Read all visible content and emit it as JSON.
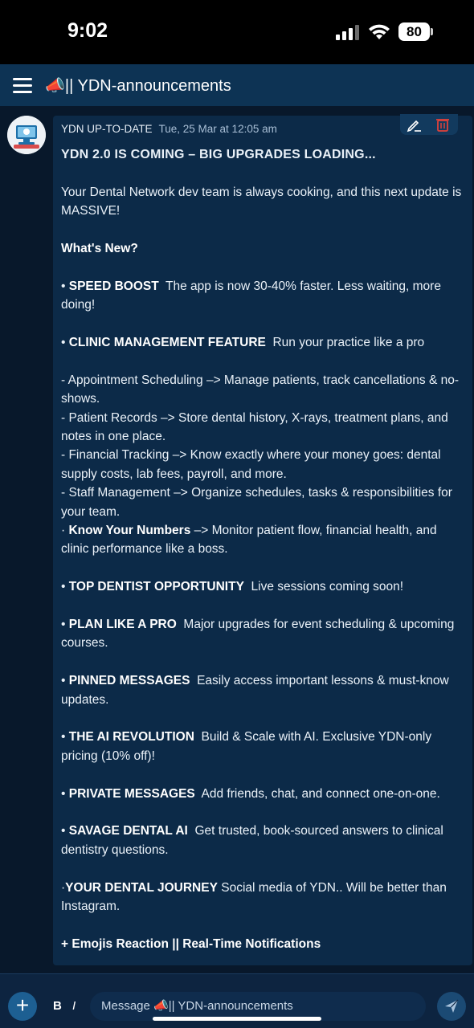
{
  "status_bar": {
    "time": "9:02",
    "battery": "80"
  },
  "header": {
    "channel_emoji": "📣",
    "channel_name": "|| YDN-announcements"
  },
  "message": {
    "author": "YDN UP-TO-DATE",
    "timestamp": "Tue, 25 Mar at 12:05 am",
    "title": "YDN 2.0 IS COMING – BIG UPGRADES LOADING...",
    "intro": "Your Dental Network dev team is always cooking, and this next update is MASSIVE!",
    "whats_new": "What's New?",
    "speed_boost_label": "SPEED BOOST",
    "speed_boost_text": "The app is now 30-40% faster. Less waiting, more doing!",
    "clinic_label": "CLINIC MANAGEMENT FEATURE",
    "clinic_text": "Run your practice like a pro",
    "appointment": "- Appointment Scheduling –> Manage patients, track cancellations & no-shows.",
    "patient_records": "- Patient Records –> Store dental history, X-rays, treatment plans, and notes in one place.",
    "financial": "- Financial Tracking –> Know exactly where your money goes: dental supply costs, lab fees, payroll, and more.",
    "staff": "- Staff Management –> Organize schedules, tasks & responsibilities for your team.",
    "numbers_label": "Know Your Numbers",
    "numbers_text": "–> Monitor patient flow, financial health, and clinic performance like a boss.",
    "top_dentist_label": "TOP DENTIST OPPORTUNITY",
    "top_dentist_text": "Live sessions coming soon!",
    "plan_label": "PLAN LIKE A PRO",
    "plan_text": "Major upgrades for event scheduling & upcoming courses.",
    "pinned_label": "PINNED MESSAGES",
    "pinned_text": "Easily access important lessons & must-know updates.",
    "ai_label": "THE AI REVOLUTION",
    "ai_text": "Build & Scale with AI. Exclusive YDN-only pricing (10% off)!",
    "private_label": "PRIVATE MESSAGES",
    "private_text": "Add friends, chat, and connect one-on-one.",
    "savage_label": "SAVAGE DENTAL AI",
    "savage_text": "Get trusted, book-sourced answers to clinical dentistry questions.",
    "journey_label": "YOUR DENTAL JOURNEY",
    "journey_text": "Social media of YDN.. Will be better than Instagram.",
    "final_line": "+ Emojis Reaction || Real-Time Notifications"
  },
  "composer": {
    "bold_label": "B",
    "italic_label": "I",
    "placeholder": "Message 📣|| YDN-announcements"
  },
  "icons": {
    "menu": "hamburger-icon",
    "edit": "edit-icon",
    "delete": "trash-icon",
    "add": "plus-icon",
    "send": "send-icon"
  },
  "colors": {
    "background": "#08182b",
    "header": "#0d3354",
    "card": "#0c2a48",
    "accent_delete": "#e0413a"
  }
}
